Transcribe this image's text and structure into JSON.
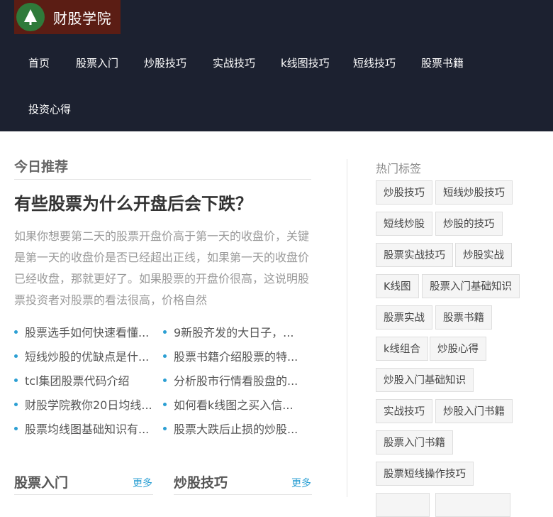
{
  "site": {
    "logo_text": "财股学院"
  },
  "nav": {
    "items": [
      "首页",
      "股票入门",
      "炒股技巧",
      "实战技巧",
      "k线图技巧",
      "短线技巧",
      "股票书籍",
      "投资心得"
    ]
  },
  "recommend": {
    "title": "今日推荐",
    "headline": "有些股票为什么开盘后会下跌？",
    "excerpt": "如果你想要第二天的股票开盘价高于第一天的收盘价，关键是第一天的收盘价是否已经超出正线，如果第一天的收盘价已经收盘，那就更好了。如果股票的开盘价很高，这说明股票投资者对股票的看法很高，价格自然",
    "links_left": [
      "股票选手如何快速看懂...",
      "短线炒股的优缺点是什...",
      "tcl集团股票代码介绍",
      "财股学院教你20日均线...",
      "股票均线图基础知识有..."
    ],
    "links_right": [
      "9新股齐发的大日子，...",
      "股票书籍介绍股票的特...",
      "分析股市行情看股盘的...",
      "如何看k线图之买入信...",
      "股票大跌后止损的炒股..."
    ]
  },
  "categories": [
    {
      "title": "股票入门",
      "more": "更多"
    },
    {
      "title": "炒股技巧",
      "more": "更多"
    }
  ],
  "tags": {
    "title": "热门标签",
    "rows": [
      [
        "炒股技巧",
        "短线炒股技巧"
      ],
      [
        "短线炒股",
        "炒股的技巧"
      ],
      [
        "股票实战技巧",
        "炒股实战"
      ],
      [
        "K线图",
        "股票入门基础知识"
      ],
      [
        "股票实战",
        "股票书籍"
      ],
      [
        "k线组合",
        "炒股心得"
      ],
      [
        "炒股入门基础知识"
      ],
      [
        "实战技巧",
        "炒股入门书籍"
      ],
      [
        "股票入门书籍"
      ],
      [
        "股票短线操作技巧"
      ]
    ]
  },
  "colors": {
    "topbar": "#1c2130",
    "logo_bg": "#5b1d14",
    "logo_badge": "#2f7a3a",
    "accent": "#2b9fd3"
  },
  "icons": {
    "logo": "tree-icon"
  }
}
